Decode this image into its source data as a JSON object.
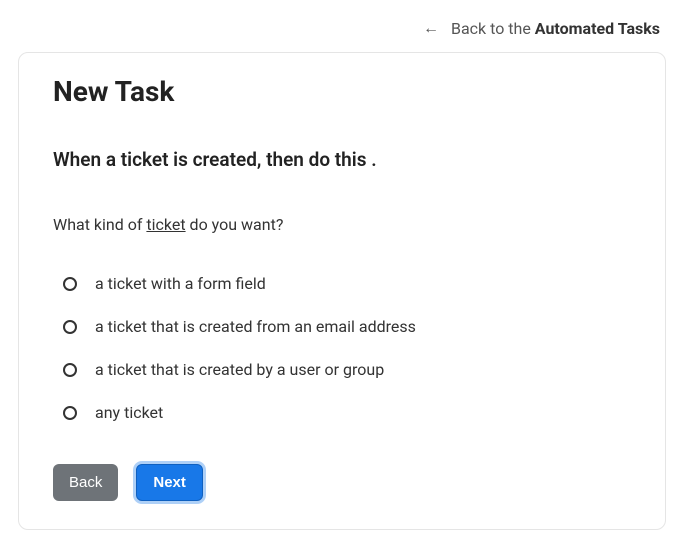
{
  "toplink": {
    "prefix": "Back to the ",
    "bold": "Automated Tasks"
  },
  "title": "New Task",
  "rule": "When a ticket is created, then do this .",
  "question": {
    "pre": "What kind of ",
    "key": "ticket",
    "post": " do you want?"
  },
  "options": [
    {
      "label": "a ticket with a form field"
    },
    {
      "label": "a ticket that is created from an email address"
    },
    {
      "label": "a ticket that is created by a user or group"
    },
    {
      "label": "any ticket"
    }
  ],
  "buttons": {
    "back": "Back",
    "next": "Next"
  }
}
